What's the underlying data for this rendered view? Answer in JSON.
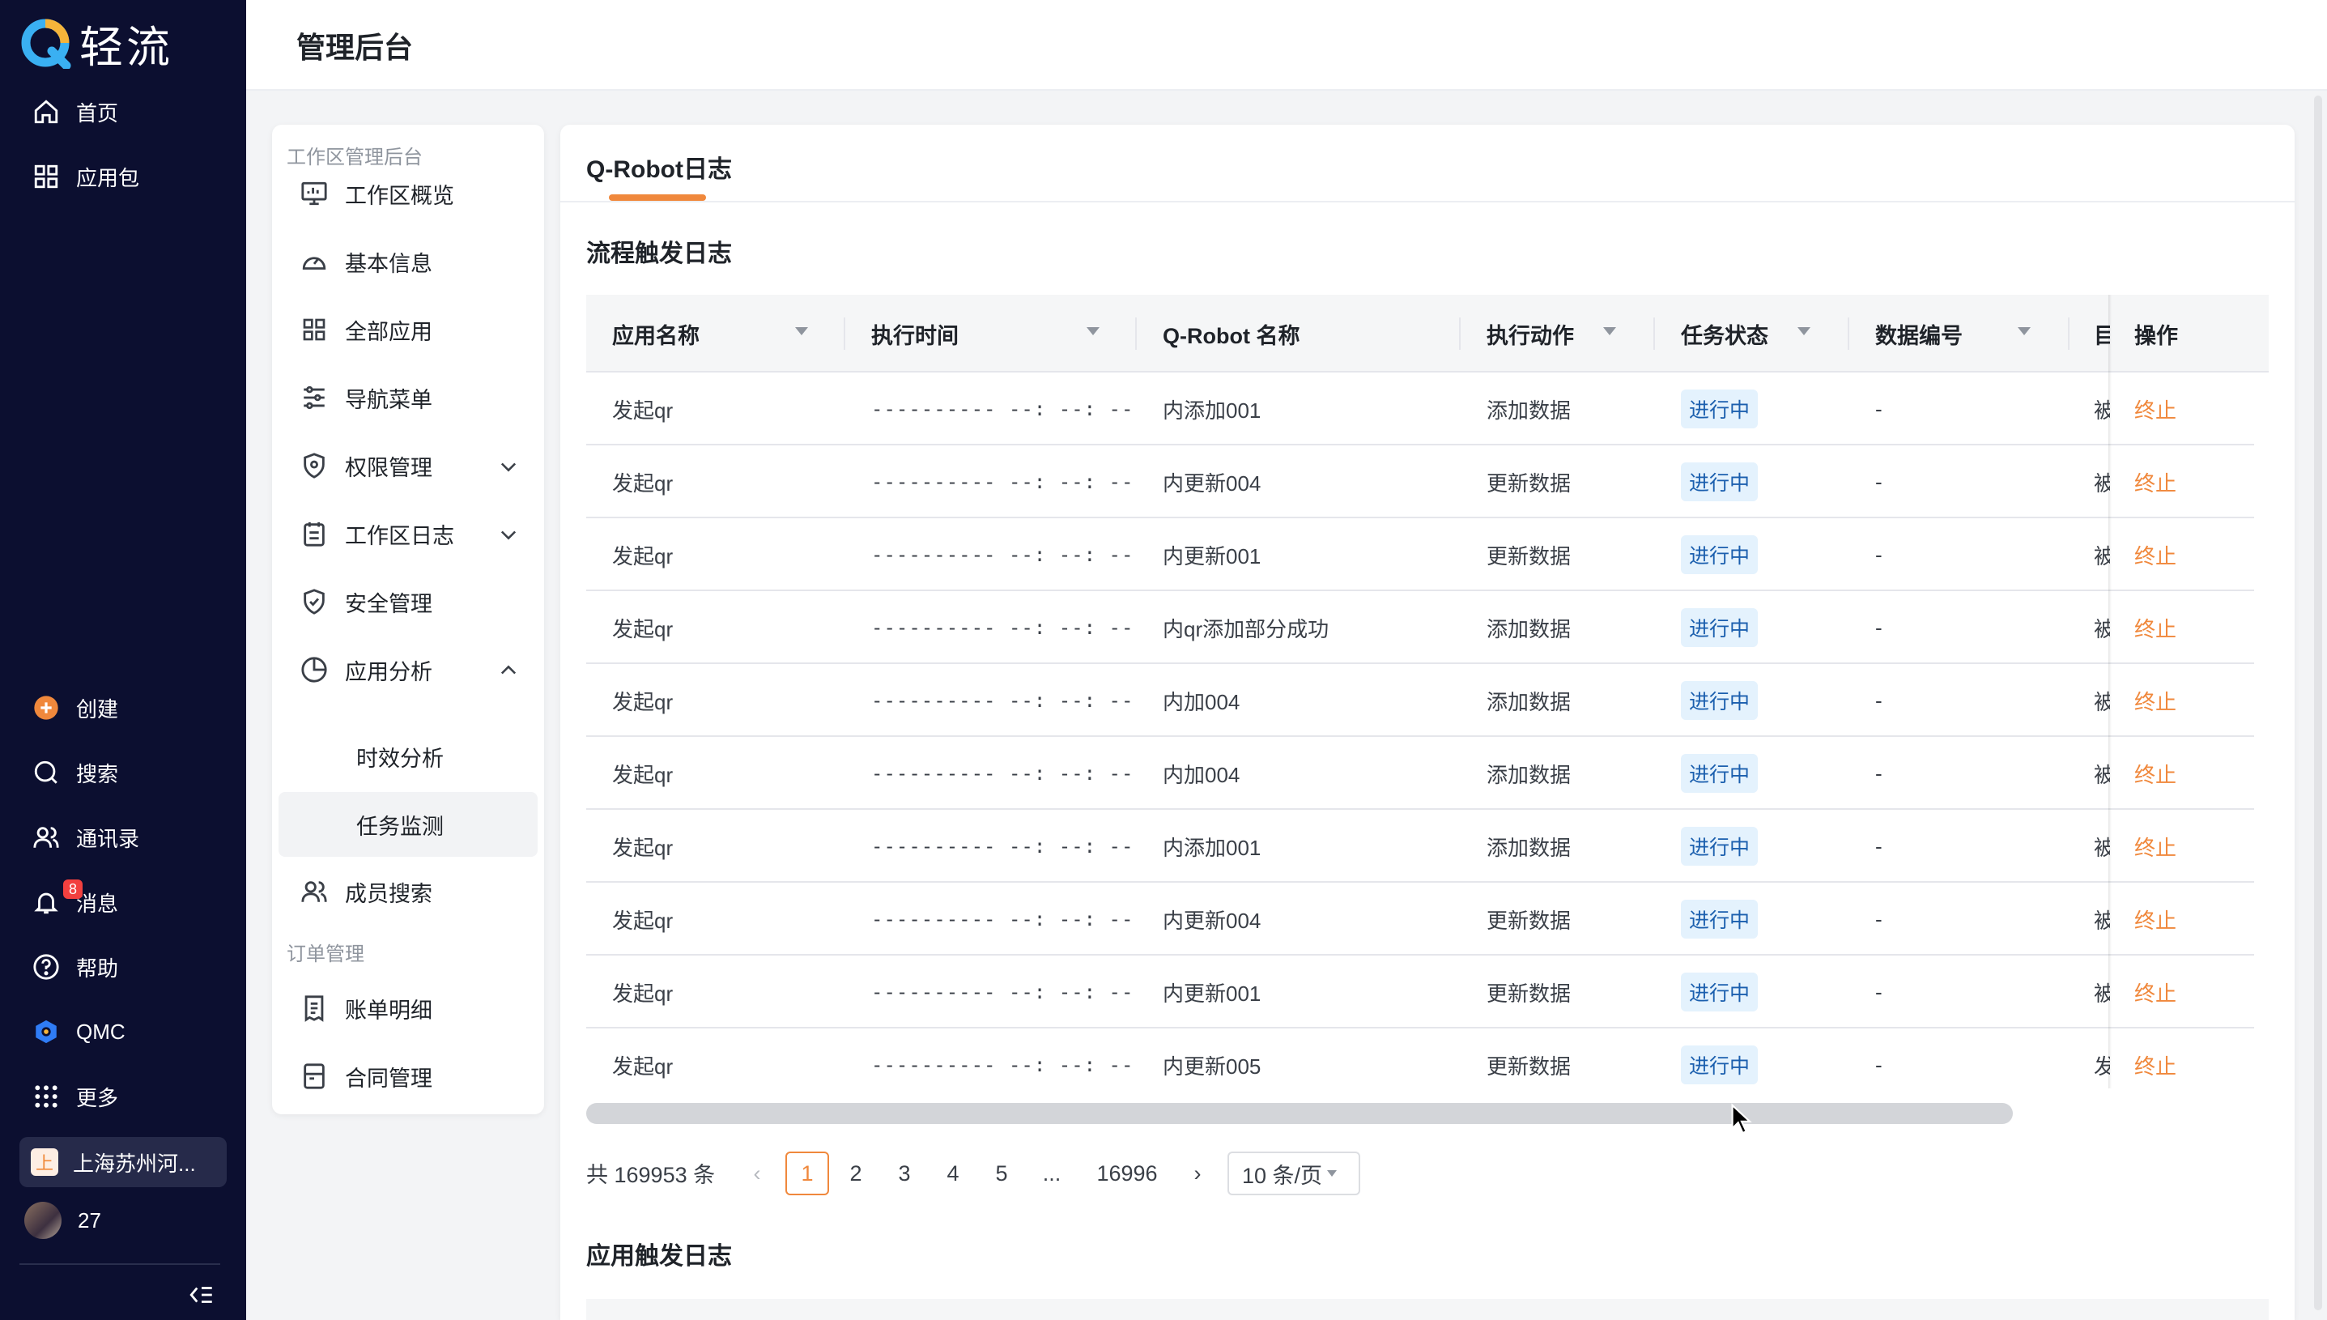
{
  "app": {
    "brand": "轻流",
    "colors": {
      "nav_bg": "#0c0f30",
      "accent": "#f0883c",
      "status_bg": "#e4f2fd",
      "status_fg": "#1b5fae"
    }
  },
  "nav": {
    "top_items": [
      {
        "label": "首页",
        "icon": "home-icon"
      },
      {
        "label": "应用包",
        "icon": "grid-icon"
      }
    ],
    "bottom_items": [
      {
        "label": "创建",
        "icon": "plus-circle-icon"
      },
      {
        "label": "搜索",
        "icon": "search-icon"
      },
      {
        "label": "通讯录",
        "icon": "contacts-icon"
      },
      {
        "label": "消息",
        "icon": "bell-icon",
        "badge": "8"
      },
      {
        "label": "帮助",
        "icon": "help-icon"
      },
      {
        "label": "QMC",
        "icon": "qmc-icon"
      },
      {
        "label": "更多",
        "icon": "apps-icon"
      }
    ],
    "workspace": {
      "icon_text": "上",
      "label": "上海苏州河..."
    },
    "user": {
      "label": "27"
    }
  },
  "header": {
    "title": "管理后台"
  },
  "sidebar": {
    "group1": "工作区管理后台",
    "items": [
      {
        "label": "工作区概览",
        "icon": "monitor-icon"
      },
      {
        "label": "基本信息",
        "icon": "dashboard-icon"
      },
      {
        "label": "全部应用",
        "icon": "grid-icon"
      },
      {
        "label": "导航菜单",
        "icon": "sliders-icon"
      },
      {
        "label": "权限管理",
        "icon": "shield-lock-icon"
      },
      {
        "label": "工作区日志",
        "icon": "calendar-icon"
      },
      {
        "label": "安全管理",
        "icon": "shield-check-icon"
      },
      {
        "label": "应用分析",
        "icon": "pie-chart-icon"
      }
    ],
    "sub_items": [
      {
        "label": "时效分析"
      },
      {
        "label": "任务监测"
      }
    ],
    "member_search": {
      "label": "成员搜索",
      "icon": "users-icon"
    },
    "group2": "订单管理",
    "order_items": [
      {
        "label": "账单明细",
        "icon": "receipt-icon"
      },
      {
        "label": "合同管理",
        "icon": "contract-icon"
      }
    ]
  },
  "main": {
    "tab": "Q-Robot日志",
    "section1_title": "流程触发日志",
    "section2_title": "应用触发日志",
    "table": {
      "headers": [
        "应用名称",
        "执行时间",
        "Q-Robot 名称",
        "执行动作",
        "任务状态",
        "数据编号",
        "目",
        "操作"
      ],
      "rows": [
        {
          "app": "发起qr",
          "time": "---------- --: --: --",
          "robot": "内添加001",
          "action": "添加数据",
          "status": "进行中",
          "num": "-",
          "extra": "被",
          "op": "终止"
        },
        {
          "app": "发起qr",
          "time": "---------- --: --: --",
          "robot": "内更新004",
          "action": "更新数据",
          "status": "进行中",
          "num": "-",
          "extra": "被",
          "op": "终止"
        },
        {
          "app": "发起qr",
          "time": "---------- --: --: --",
          "robot": "内更新001",
          "action": "更新数据",
          "status": "进行中",
          "num": "-",
          "extra": "被",
          "op": "终止"
        },
        {
          "app": "发起qr",
          "time": "---------- --: --: --",
          "robot": "内qr添加部分成功",
          "action": "添加数据",
          "status": "进行中",
          "num": "-",
          "extra": "被",
          "op": "终止"
        },
        {
          "app": "发起qr",
          "time": "---------- --: --: --",
          "robot": "内加004",
          "action": "添加数据",
          "status": "进行中",
          "num": "-",
          "extra": "被",
          "op": "终止"
        },
        {
          "app": "发起qr",
          "time": "---------- --: --: --",
          "robot": "内加004",
          "action": "添加数据",
          "status": "进行中",
          "num": "-",
          "extra": "被",
          "op": "终止"
        },
        {
          "app": "发起qr",
          "time": "---------- --: --: --",
          "robot": "内添加001",
          "action": "添加数据",
          "status": "进行中",
          "num": "-",
          "extra": "被",
          "op": "终止"
        },
        {
          "app": "发起qr",
          "time": "---------- --: --: --",
          "robot": "内更新004",
          "action": "更新数据",
          "status": "进行中",
          "num": "-",
          "extra": "被",
          "op": "终止"
        },
        {
          "app": "发起qr",
          "time": "---------- --: --: --",
          "robot": "内更新001",
          "action": "更新数据",
          "status": "进行中",
          "num": "-",
          "extra": "被",
          "op": "终止"
        },
        {
          "app": "发起qr",
          "time": "---------- --: --: --",
          "robot": "内更新005",
          "action": "更新数据",
          "status": "进行中",
          "num": "-",
          "extra": "发",
          "op": "终止"
        }
      ]
    },
    "pagination": {
      "total": "共 169953 条",
      "prev": "‹",
      "pages": [
        "1",
        "2",
        "3",
        "4",
        "5"
      ],
      "ellipsis": "...",
      "last": "16996",
      "next": "›",
      "page_size": "10 条/页",
      "current": "1"
    }
  }
}
